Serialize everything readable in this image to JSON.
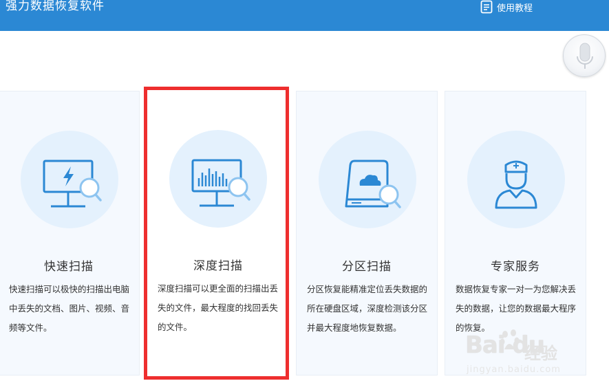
{
  "header": {
    "title": "强力数据恢复软件",
    "tutorial_label": "使用教程"
  },
  "cards": [
    {
      "title": "快速扫描",
      "description": "快速扫描可以极快的扫描出电脑中丢失的文档、图片、视频、音频等文件。",
      "icon": "monitor-lightning-search-icon"
    },
    {
      "title": "深度扫描",
      "description": "深度扫描可以更全面的扫描出丢失的文件，最大程度的找回丢失的文件。",
      "icon": "monitor-chart-search-icon"
    },
    {
      "title": "分区扫描",
      "description": "分区恢复能精准定位丢失数据的所在硬盘区域，深度检测该分区并最大程度地恢复数据。",
      "icon": "disk-cloud-search-icon"
    },
    {
      "title": "专家服务",
      "description": "数据恢复专家一对一为您解决丢失的数据，让您的数据最大程序的恢复。",
      "icon": "doctor-icon"
    }
  ],
  "watermark": {
    "logo": "Bai du",
    "text": "经验",
    "url": "jingyan.baidu.com"
  },
  "colors": {
    "header": "#2b88d4",
    "icon": "#2b88d4",
    "card_bg": "#f5f9fe",
    "circle_bg": "#e4f1fd",
    "highlight": "#ee2e2e"
  }
}
